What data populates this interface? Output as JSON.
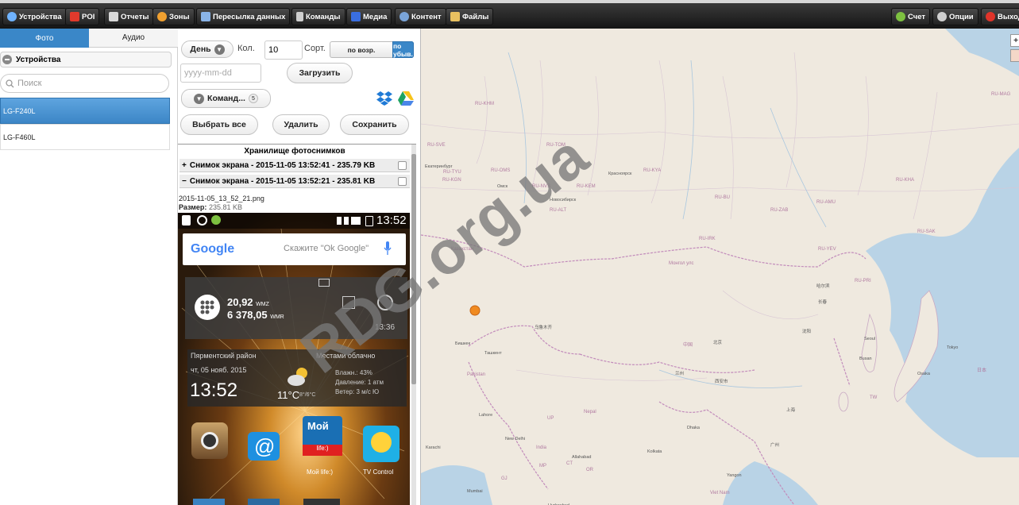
{
  "toolbar": {
    "items": [
      {
        "label": "Устройства",
        "icon": "eye-icon"
      },
      {
        "label": "POI",
        "icon": "pin-icon"
      },
      {
        "label": "Отчеты",
        "icon": "report-icon"
      },
      {
        "label": "Зоны",
        "icon": "zone-icon"
      },
      {
        "label": "Пересылка данных",
        "icon": "transfer-icon"
      },
      {
        "label": "Команды",
        "icon": "phone-icon"
      },
      {
        "label": "Медиа",
        "icon": "media-icon"
      },
      {
        "label": "Контент",
        "icon": "globe-icon"
      },
      {
        "label": "Файлы",
        "icon": "folder-icon"
      }
    ],
    "right_items": [
      {
        "label": "Счет",
        "icon": "account-icon"
      },
      {
        "label": "Опции",
        "icon": "gear-icon"
      },
      {
        "label": "Выход",
        "icon": "power-icon"
      }
    ]
  },
  "left": {
    "tabs": [
      "Фото",
      "Аудио"
    ],
    "devices_header": "Устройства",
    "search_placeholder": "Поиск",
    "devices": [
      "LG-F240L",
      "LG-F460L"
    ]
  },
  "controls": {
    "period": "День",
    "count_label": "Кол.",
    "count_value": "10",
    "sort_label": "Сорт.",
    "sort_asc": "по возр.",
    "sort_desc": "по убыв.",
    "date_placeholder": "yyyy-mm-dd",
    "load_button": "Загрузить",
    "commands_button": "Команд...",
    "commands_count": "5",
    "select_all": "Выбрать все",
    "delete": "Удалить",
    "save": "Сохранить"
  },
  "storage": {
    "title": "Хранилище фотоснимков",
    "items": [
      {
        "toggle": "+",
        "label": "Снимок экрана - 2015-11-05 13:52:41 - 235.79 KB"
      },
      {
        "toggle": "−",
        "label": "Снимок экрана - 2015-11-05 13:52:21 - 235.81 KB"
      }
    ],
    "file_name": "2015-11-05_13_52_21.png",
    "file_size_label": "Размер:",
    "file_size": "235.81 KB"
  },
  "phone": {
    "time": "13:52",
    "google_logo": "Google",
    "google_hint": "Скажите \"Ok Google\"",
    "wm_value1": "20,92",
    "wm_unit1": "WMZ",
    "wm_value2": "6 378,05",
    "wm_unit2": "WMR",
    "wm_time": "13:36",
    "weather_location": "Пярментский район",
    "weather_desc": "Местами облачно",
    "weather_date": "чт, 05 нояб. 2015",
    "weather_clock": "13:52",
    "weather_temp": "11°C",
    "weather_temp_range": "8°/6°C",
    "weather_humidity": "Влажн.: 43%",
    "weather_pressure": "Давление: 1 атм",
    "weather_wind": "Ветер: 3 м/с Ю",
    "apps": [
      {
        "label": "",
        "icon": "camera-app-icon"
      },
      {
        "label": "",
        "icon": "mail-app-icon"
      },
      {
        "label": "Мой life:)",
        "icon": "life-app-icon"
      },
      {
        "label": "TV Control",
        "icon": "tv-app-icon"
      }
    ],
    "life_tile_text": "Мой",
    "life_tile_sub": "life:)"
  },
  "map": {
    "countries": [
      {
        "name": "RU-KHM"
      },
      {
        "name": "RU-SVE"
      },
      {
        "name": "RU-TYU"
      },
      {
        "name": "RU-OMS"
      },
      {
        "name": "RU-TOM"
      },
      {
        "name": "RU-KGN"
      },
      {
        "name": "RU-NVS"
      },
      {
        "name": "RU-KEM"
      },
      {
        "name": "RU-KYA"
      },
      {
        "name": "RU-ALT"
      },
      {
        "name": "RU-IRK"
      },
      {
        "name": "RU-ZAB"
      },
      {
        "name": "RU-BU"
      },
      {
        "name": "RU-AMU"
      },
      {
        "name": "RU-KHA"
      },
      {
        "name": "RU-MAG"
      },
      {
        "name": "RU-SAK"
      },
      {
        "name": "RU-YEV"
      },
      {
        "name": "RU-PRI"
      },
      {
        "name": "Казахстан"
      },
      {
        "name": "Монгол улс"
      },
      {
        "name": "中国"
      },
      {
        "name": "日本"
      },
      {
        "name": "India"
      },
      {
        "name": "Pakistan"
      },
      {
        "name": "Nepal"
      },
      {
        "name": "Viet Nam"
      },
      {
        "name": "TW"
      },
      {
        "name": "UP"
      },
      {
        "name": "MP"
      },
      {
        "name": "CT"
      },
      {
        "name": "OR"
      },
      {
        "name": "GJ"
      }
    ],
    "cities": [
      {
        "name": "Екатеринбург"
      },
      {
        "name": "Омск"
      },
      {
        "name": "Новосибирск"
      },
      {
        "name": "Красноярск"
      },
      {
        "name": "Бишкек"
      },
      {
        "name": "Ташкент"
      },
      {
        "name": "乌鲁木齐"
      },
      {
        "name": "哈尔滨"
      },
      {
        "name": "长春"
      },
      {
        "name": "沈阳"
      },
      {
        "name": "北京"
      },
      {
        "name": "兰州"
      },
      {
        "name": "西安市"
      },
      {
        "name": "上海"
      },
      {
        "name": "广州"
      },
      {
        "name": "Lahore"
      },
      {
        "name": "New Delhi"
      },
      {
        "name": "Karachi"
      },
      {
        "name": "Allahabad"
      },
      {
        "name": "Seoul"
      },
      {
        "name": "Busan"
      },
      {
        "name": "Tokyo"
      },
      {
        "name": "Osaka"
      },
      {
        "name": "Kolkata"
      },
      {
        "name": "Dhaka"
      },
      {
        "name": "Yangon"
      },
      {
        "name": "Mumbai"
      },
      {
        "name": "Hyderabad"
      }
    ]
  },
  "watermark": "RDG.org.ua"
}
